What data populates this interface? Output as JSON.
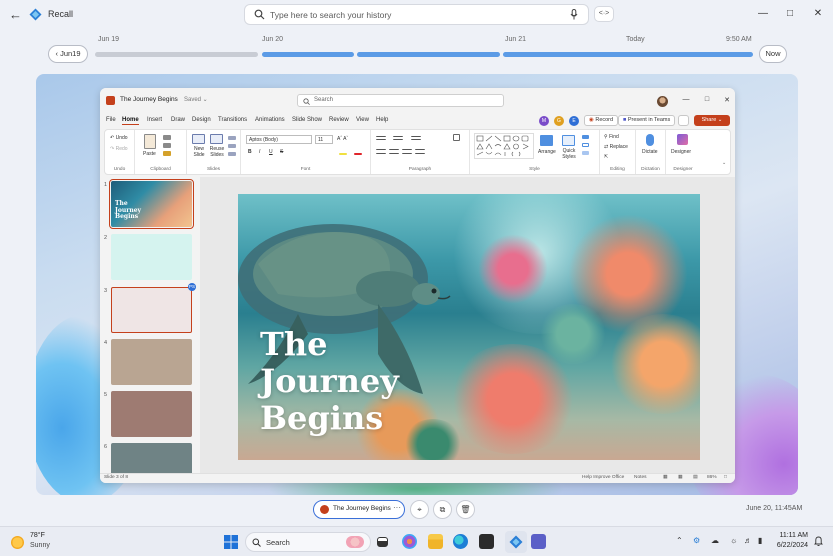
{
  "app": {
    "title": "Recall"
  },
  "search": {
    "placeholder": "Type here to search your history"
  },
  "timeline": {
    "labels": [
      "Jun 19",
      "Jun 20",
      "Jun 21",
      "Today",
      "9:50 AM"
    ],
    "jump_back_label": "Jun19",
    "now_label": "Now"
  },
  "ppt": {
    "doc_title": "The Journey Begins",
    "saved_status": "Saved",
    "search_placeholder": "Search",
    "menu": [
      "File",
      "Home",
      "Insert",
      "Draw",
      "Design",
      "Transitions",
      "Animations",
      "Slide Show",
      "Review",
      "View",
      "Help"
    ],
    "active_menu": "Home",
    "record_label": "Record",
    "teams_label": "Present in Teams",
    "share_label": "Share",
    "ribbon": {
      "undo_label": "Undo",
      "redo_label": "Redo",
      "paste_label": "Paste",
      "new_slide_label": "New Slide",
      "reuse_slides_label": "Reuse Slides",
      "font_name": "Aptos (Body)",
      "font_size": "11",
      "font_buttons": [
        "B",
        "I",
        "U",
        "S"
      ],
      "arrange_label": "Arrange",
      "quick_styles_label": "Quick Styles",
      "find_label": "Find",
      "replace_label": "Replace",
      "dictate_label": "Dictate",
      "designer_label": "Designer",
      "groups": [
        "Undo",
        "Clipboard",
        "Slides",
        "Font",
        "Paragraph",
        "Style",
        "Editing",
        "Dictation",
        "Designer"
      ]
    },
    "slide_numbers": [
      "1",
      "2",
      "3",
      "4",
      "5",
      "6"
    ],
    "thumb1_title": "The Journey Begins",
    "thumb_colors": [
      "#d5f3ef",
      "#efe5e5",
      "#b9a592",
      "#9e7b72",
      "#6f8385"
    ],
    "thumb_badge": "PS",
    "coauthors": [
      {
        "initial": "M",
        "color": "#7a4cc9"
      },
      {
        "initial": "G",
        "color": "#e0a020"
      },
      {
        "initial": "E",
        "color": "#2f6fd6"
      }
    ],
    "slide_title": "The\nJourney\nBegins",
    "status_left": "Slide 3 of 8",
    "status_help": "Help Improve Office",
    "status_notes": "Notes",
    "status_zoom": "86%"
  },
  "snapshot": {
    "app_name": "The Journey Begins",
    "more": "···",
    "time": "June 20, 11:45AM"
  },
  "taskbar": {
    "weather_temp": "78°F",
    "weather_desc": "Sunny",
    "search_label": "Search",
    "time": "11:11 AM",
    "date": "6/22/2024"
  }
}
